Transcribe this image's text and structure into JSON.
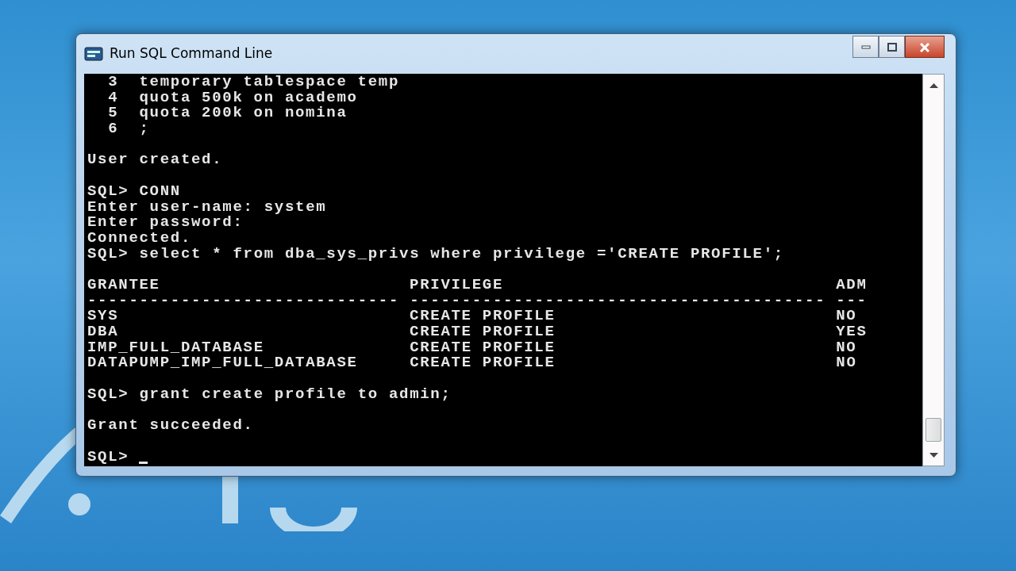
{
  "window": {
    "title": "Run SQL Command Line",
    "controls": [
      {
        "kind": "minimize"
      },
      {
        "kind": "maximize"
      },
      {
        "kind": "close"
      }
    ]
  },
  "console": [
    {
      "kind": "numbered",
      "number": "3",
      "text": "temporary tablespace temp"
    },
    {
      "kind": "numbered",
      "number": "4",
      "text": "quota 500k on academo"
    },
    {
      "kind": "numbered",
      "number": "5",
      "text": "quota 200k on nomina"
    },
    {
      "kind": "numbered",
      "number": "6",
      "text": ";"
    },
    {
      "kind": "blank"
    },
    {
      "kind": "text",
      "text": "User created."
    },
    {
      "kind": "blank"
    },
    {
      "kind": "prompt",
      "prompt": "SQL>",
      "text": "CONN"
    },
    {
      "kind": "text",
      "text": "Enter user-name: system"
    },
    {
      "kind": "text",
      "text": "Enter password:"
    },
    {
      "kind": "text",
      "text": "Connected."
    },
    {
      "kind": "prompt",
      "prompt": "SQL>",
      "text": "select * from dba_sys_privs where privilege ='CREATE PROFILE';"
    },
    {
      "kind": "blank"
    },
    {
      "kind": "table",
      "columns": [
        {
          "heading": "GRANTEE",
          "underline": "------------------------------"
        },
        {
          "heading": "PRIVILEGE",
          "underline": "----------------------------------------"
        },
        {
          "heading": "ADM",
          "underline": "---"
        }
      ],
      "rows": [
        [
          "SYS",
          "CREATE PROFILE",
          "NO"
        ],
        [
          "DBA",
          "CREATE PROFILE",
          "YES"
        ],
        [
          "IMP_FULL_DATABASE",
          "CREATE PROFILE",
          "NO"
        ],
        [
          "DATAPUMP_IMP_FULL_DATABASE",
          "CREATE PROFILE",
          "NO"
        ]
      ]
    },
    {
      "kind": "blank"
    },
    {
      "kind": "prompt",
      "prompt": "SQL>",
      "text": "grant create profile to admin;"
    },
    {
      "kind": "blank"
    },
    {
      "kind": "text",
      "text": "Grant succeeded."
    },
    {
      "kind": "blank"
    },
    {
      "kind": "cursor",
      "prompt": "SQL>"
    }
  ]
}
